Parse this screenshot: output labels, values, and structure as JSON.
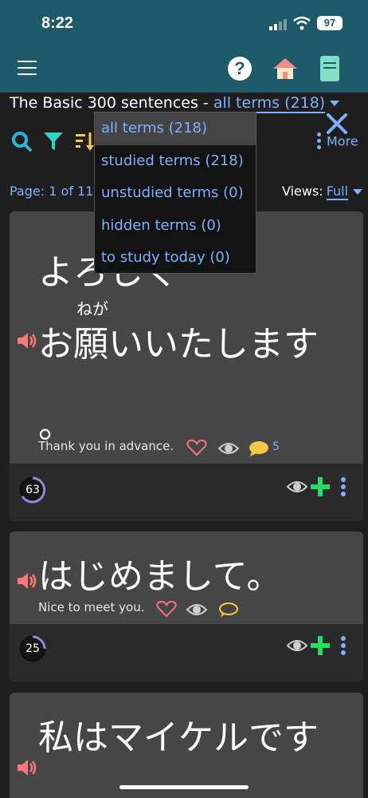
{
  "status": {
    "time": "8:22",
    "battery": "97"
  },
  "header": {
    "title": "The Basic 300 sentences - ",
    "filter_label": "all terms (218)"
  },
  "toolbar": {
    "more_label": "More"
  },
  "paging": {
    "page_text": "Page: 1 of 11",
    "views_label": "Views:",
    "views_value": "Full"
  },
  "dropdown": {
    "items": [
      {
        "label": "all terms (218)",
        "selected": true
      },
      {
        "label": "studied terms (218)"
      },
      {
        "label": "unstudied terms (0)"
      },
      {
        "label": "hidden terms (0)"
      },
      {
        "label": "to study today (0)"
      }
    ]
  },
  "cards": [
    {
      "jp_line1": "よろしく",
      "ruby": "ねが",
      "jp_line2": "お願いいたします",
      "jp_line3": "。",
      "en": "Thank you in advance.",
      "comments": "5",
      "progress": "63"
    },
    {
      "jp_line1": "はじめまして。",
      "en": "Nice to meet you.",
      "progress": "25"
    },
    {
      "jp_line1": "私はマイケルです",
      "jp_line2": "。"
    }
  ],
  "colors": {
    "accent": "#7fb0ff",
    "header": "#1f5a6b",
    "plus": "#22dd66",
    "speaker": "#ff7777",
    "heart": "#ff7080"
  }
}
